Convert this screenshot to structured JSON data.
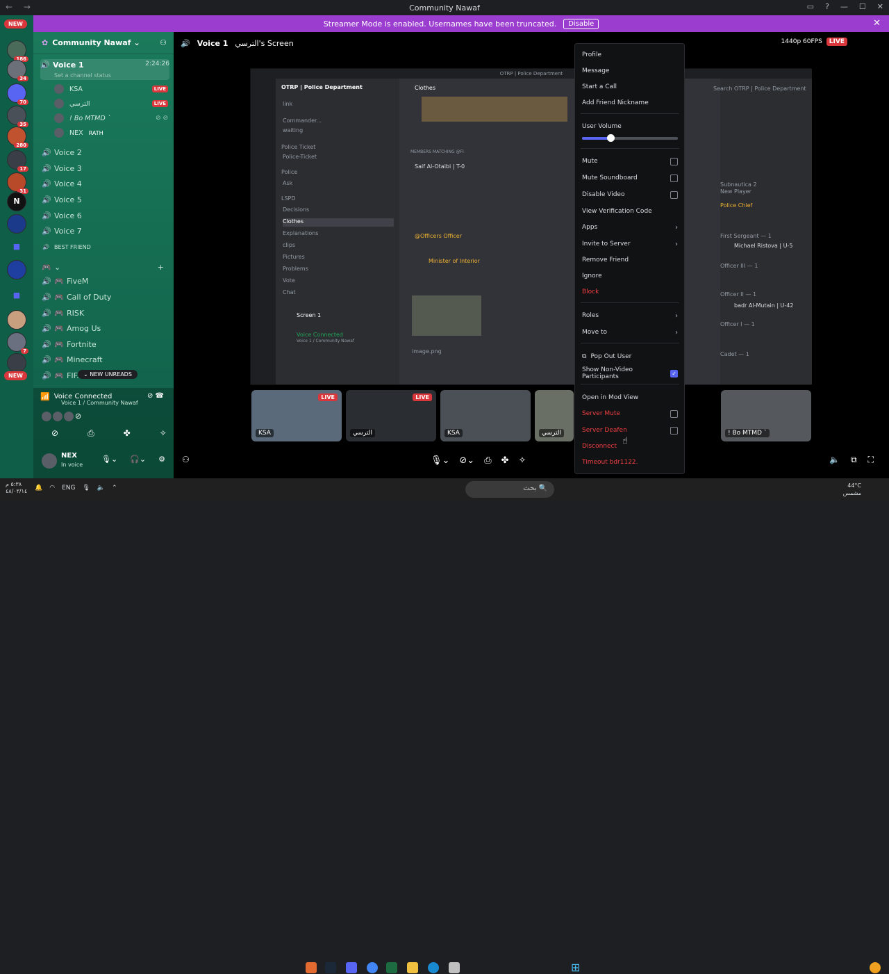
{
  "window": {
    "title": "Community Nawaf"
  },
  "banner": {
    "text": "Streamer Mode is enabled. Usernames have been truncated.",
    "button": "Disable"
  },
  "rail": {
    "new_top": "NEW",
    "new_bottom": "NEW",
    "badges": [
      "186",
      "34",
      "70",
      "35",
      "280",
      "17",
      "31",
      "7"
    ]
  },
  "guild": {
    "name": "Community Nawaf"
  },
  "active_channel": {
    "name": "Voice 1",
    "timer": "2:24:26",
    "status": "Set a channel status"
  },
  "members": [
    {
      "name": "KSA",
      "live": "LIVE"
    },
    {
      "name": "الترسي",
      "live": "LIVE"
    },
    {
      "name": "! Bo MTMD `",
      "live": ""
    },
    {
      "name": "NEX",
      "tag": "RATH",
      "live": ""
    }
  ],
  "voice_channels": [
    "Voice 2",
    "Voice 3",
    "Voice 4",
    "Voice 5",
    "Voice 6",
    "Voice 7"
  ],
  "best_friend": "BEST FRIEND",
  "games": [
    "FiveM",
    "Call of Duty",
    "RISK",
    "Amog Us",
    "Fortnite",
    "Minecraft",
    "FIF..."
  ],
  "new_unreads": "NEW UNREADS",
  "voice_connected": {
    "title": "Voice Connected",
    "sub": "Voice 1 / Community Nawaf"
  },
  "user": {
    "name": "NEX",
    "status": "In voice"
  },
  "header": {
    "channel": "Voice 1",
    "screen": "الترسي's Screen",
    "quality": "1440p 60FPS",
    "live": "LIVE"
  },
  "shared": {
    "server": "OTRP | Police Department",
    "channel": "Clothes",
    "title": "OTRP | Police Department",
    "search": "Search OTRP | Police Department",
    "channels": [
      "link",
      "Commander...",
      "waiting",
      "Police Ticket",
      "Police-Ticket",
      "Police",
      "Ask",
      "LSPD",
      "Decisions",
      "Clothes",
      "Explanations",
      "clips",
      "Pictures",
      "Problems",
      "Vote",
      "Chat"
    ],
    "members_label": "MEMBERS MATCHING @FI",
    "match": "Saif Al-Otaibi | T-0",
    "officers": "@Officers Officer",
    "minister": "Minister of Interior",
    "image": "image.png",
    "screen": "Screen 1",
    "vc": "Voice Connected",
    "vc_sub": "Voice 1 / Community Nawaf",
    "chief": "Police Chief",
    "sergeant": "First Sergeant — 1",
    "michael": "Michael Ristova | U-5",
    "officer3": "Officer III — 1",
    "officer2": "Officer II — 1",
    "badr": "badr Al-Mutain | U-42",
    "officer1": "Officer I — 1",
    "cadet": "Cadet — 1",
    "game": "Subnautica 2",
    "newplayer": "New Player"
  },
  "tiles": [
    {
      "label": "KSA",
      "live": "LIVE"
    },
    {
      "label": "الترسي",
      "live": "LIVE"
    },
    {
      "label": "KSA",
      "live": ""
    },
    {
      "label": "الترسي",
      "live": ""
    },
    {
      "label": "! Bo MTMD `",
      "live": ""
    }
  ],
  "menu": {
    "profile": "Profile",
    "message": "Message",
    "start_call": "Start a Call",
    "nickname": "Add Friend Nickname",
    "volume": "User Volume",
    "volume_level": 0.3,
    "mute": "Mute",
    "mute_soundboard": "Mute Soundboard",
    "disable_video": "Disable Video",
    "verification": "View Verification Code",
    "apps": "Apps",
    "invite": "Invite to Server",
    "remove_friend": "Remove Friend",
    "ignore": "Ignore",
    "block": "Block",
    "roles": "Roles",
    "move_to": "Move to",
    "pop_out": "Pop Out User",
    "show_nonvideo": "Show Non-Video Participants",
    "mod_view": "Open in Mod View",
    "server_mute": "Server Mute",
    "server_deafen": "Server Deafen",
    "disconnect": "Disconnect",
    "timeout": "Timeout bdr1122."
  },
  "taskbar": {
    "search": "بحث",
    "lang": "ENG",
    "time": "٥:٣٨ م",
    "date": "٤٨/٠٣/١٤",
    "temp": "44°C",
    "weather": "مشمس"
  }
}
